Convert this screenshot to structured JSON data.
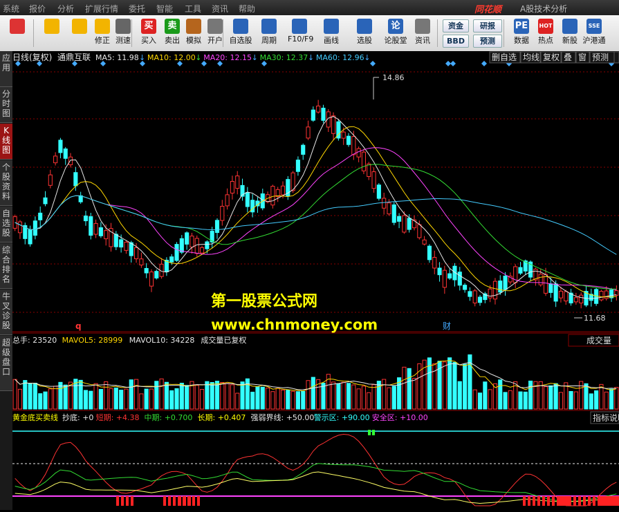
{
  "menu": [
    "系统",
    "报价",
    "分析",
    "扩展行情",
    "委托",
    "智能",
    "工具",
    "资讯",
    "帮助"
  ],
  "brand": "同花顺",
  "app_title": "A股技术分析",
  "toolbar": {
    "buttons": [
      {
        "label": "",
        "icon": "grid-icon",
        "color": "#d33"
      },
      {
        "label": "",
        "icon": "back-arrow-icon",
        "color": "#f2b400"
      },
      {
        "label": "",
        "icon": "up-down-arrows-icon",
        "color": "#f2b400"
      },
      {
        "label": "修正",
        "icon": "clock-refresh-icon",
        "color": "#f2b400"
      },
      {
        "label": "测速",
        "icon": "stopwatch-icon",
        "color": "#666"
      },
      {
        "label": "买入",
        "icon": "buy-icon",
        "glyph": "买",
        "color": "#d22"
      },
      {
        "label": "卖出",
        "icon": "sell-icon",
        "glyph": "卖",
        "color": "#1a9a1a"
      },
      {
        "label": "模拟",
        "icon": "hammer-icon",
        "color": "#b5651d"
      },
      {
        "label": "开户",
        "icon": "lock-icon",
        "color": "#777"
      },
      {
        "label": "自选股",
        "icon": "star-folder-icon",
        "color": "#2a64b8"
      },
      {
        "label": "周期",
        "icon": "cycle-clock-icon",
        "color": "#2a64b8"
      },
      {
        "label": "F10/F9",
        "icon": "window-icon",
        "color": "#2a64b8"
      },
      {
        "label": "画线",
        "icon": "pencil-icon",
        "color": "#2a64b8"
      },
      {
        "label": "选股",
        "icon": "screen-icon",
        "color": "#2a64b8"
      },
      {
        "label": "论股堂",
        "icon": "chat-icon",
        "glyph": "论",
        "color": "#2a64b8"
      },
      {
        "label": "资讯",
        "icon": "document-icon",
        "color": "#777"
      },
      {
        "label": "数据",
        "icon": "pe-icon",
        "glyph": "PE",
        "color": "#2a64b8"
      },
      {
        "label": "热点",
        "icon": "hot-icon",
        "glyph": "HOT",
        "color": "#d22"
      },
      {
        "label": "新股",
        "icon": "new-stock-icon",
        "color": "#2a64b8"
      },
      {
        "label": "沪港通",
        "icon": "sse-hkex-icon",
        "glyph": "SSE",
        "color": "#2a64b8"
      }
    ],
    "small_buttons": [
      "资金",
      "BBD",
      "研报",
      "预测"
    ]
  },
  "sidebar_tabs": [
    {
      "label": "应用",
      "active": false
    },
    {
      "label": "分时图",
      "active": false
    },
    {
      "label": "K线图",
      "active": true
    },
    {
      "label": "个股资料",
      "active": false
    },
    {
      "label": "自选股",
      "active": false
    },
    {
      "label": "综合排名",
      "active": false
    },
    {
      "label": "牛叉诊股",
      "active": false
    },
    {
      "label": "超级盘口",
      "active": false
    }
  ],
  "kline_header": {
    "period": "日线(复权)",
    "stock_name": "通鼎互联",
    "ma": [
      {
        "label": "MA5: 11.98",
        "color": "#e8e8e8"
      },
      {
        "label": "MA10: 12.00",
        "color": "#ffd700"
      },
      {
        "label": "MA20: 12.15",
        "color": "#ff44ff"
      },
      {
        "label": "MA30: 12.37",
        "color": "#33dd33"
      },
      {
        "label": "MA60: 12.96",
        "color": "#44ccff"
      }
    ],
    "buttons": [
      "删自选",
      "均线",
      "复权",
      "叠",
      "窗",
      "预测"
    ]
  },
  "price_chart": {
    "high_label": "14.86",
    "low_label": "11.68",
    "q_marker": "q",
    "cai_marker": "财"
  },
  "watermark": {
    "line1": "第一股票公式网",
    "line2": "www.chnmoney.com"
  },
  "volume_header": {
    "items": [
      {
        "label": "总手: 23520",
        "color": "#e8e8e8"
      },
      {
        "label": "MAVOL5: 28999",
        "color": "#ffd700"
      },
      {
        "label": "MAVOL10: 34228",
        "color": "#e8e8e8"
      },
      {
        "label": "成交量已复权",
        "color": "#e8e8e8"
      }
    ],
    "button": "成交量"
  },
  "indicator_header": {
    "items": [
      {
        "label": "黄金底买卖线",
        "color": "#ffff00"
      },
      {
        "label": "抄底: +0",
        "color": "#e8e8e8"
      },
      {
        "label": "短期: +4.38",
        "color": "#ff3333"
      },
      {
        "label": "中期: +0.700",
        "color": "#33dd33"
      },
      {
        "label": "长期: +0.407",
        "color": "#ffff00"
      },
      {
        "label": "强弱界线: +50.00",
        "color": "#e8e8e8"
      },
      {
        "label": "警示区: +90.00",
        "color": "#33ffff"
      },
      {
        "label": "安全区: +10.00",
        "color": "#ff44ff"
      }
    ],
    "button": "指标说明"
  },
  "colors": {
    "up": "#ff3333",
    "down": "#33ffff",
    "grid": "#8b0000"
  }
}
